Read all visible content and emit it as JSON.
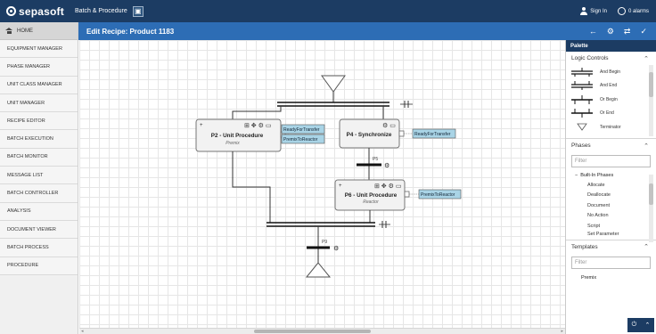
{
  "brand": {
    "logo": "sepasoft",
    "product": "Batch & Procedure"
  },
  "top_right": {
    "sign_in": "Sign In",
    "alarms": "0 alarms"
  },
  "nav": {
    "home": "HOME",
    "items": [
      "EQUIPMENT MANAGER",
      "PHASE MANAGER",
      "UNIT CLASS MANAGER",
      "UNIT MANAGER",
      "RECIPE EDITOR",
      "BATCH EXECUTION",
      "BATCH MONITOR",
      "MESSAGE LIST",
      "BATCH CONTROLLER",
      "ANALYSIS",
      "DOCUMENT VIEWER",
      "BATCH PROCESS",
      "PROCEDURE"
    ]
  },
  "title_bar": {
    "title": "Edit Recipe: Product 1183"
  },
  "diagram": {
    "p2": {
      "title": "P2 - Unit Procedure",
      "subtitle": "Premix",
      "plus": "+"
    },
    "p4": {
      "title": "P4 - Synchronize"
    },
    "p6": {
      "title": "P6 - Unit Procedure",
      "subtitle": "Reactor",
      "plus": "+"
    },
    "p5": "P5",
    "p9": "P9",
    "tags": [
      "ReadyForTransfer",
      "PremixToReactor",
      "ReadyForTransfer",
      "PremixToReactor"
    ]
  },
  "palette": {
    "header": "Palette",
    "logic_controls": {
      "title": "Logic Controls",
      "items": [
        "And Begin",
        "And End",
        "Or Begin",
        "Or End",
        "Terminator"
      ]
    },
    "phases": {
      "title": "Phases",
      "filter_placeholder": "Filter",
      "group": "Built-In Phases",
      "items": [
        "Allocate",
        "Deallocate",
        "Document",
        "No Action",
        "Script",
        "Set Parameter"
      ]
    },
    "templates": {
      "title": "Templates",
      "filter_placeholder": "Filter",
      "items": [
        "Premix"
      ]
    }
  },
  "colors": {
    "topbar": "#1c3c63",
    "titlebar": "#2d6db5",
    "tag_fill": "#a9d4e6"
  }
}
